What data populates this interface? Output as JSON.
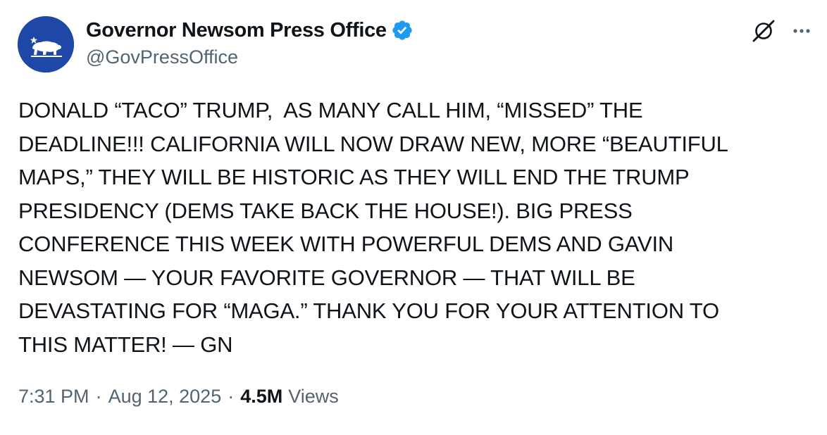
{
  "author": {
    "display_name": "Governor Newsom Press Office",
    "handle": "@GovPressOffice",
    "verified": true,
    "avatar_icon": "california-bear-icon",
    "avatar_color": "#1f47a8",
    "verified_color": "#1d9bf0"
  },
  "tweet": {
    "text_lines": [
      "DONALD “TACO” TRUMP,  AS MANY CALL HIM, “MISSED” THE",
      "DEADLINE!!! CALIFORNIA WILL NOW DRAW NEW, MORE “BEAUTIFUL",
      "MAPS,” THEY WILL BE HISTORIC AS THEY WILL END THE TRUMP",
      "PRESIDENCY (DEMS TAKE BACK THE HOUSE!). BIG PRESS",
      "CONFERENCE THIS WEEK WITH POWERFUL DEMS AND GAVIN",
      "NEWSOM — YOUR FAVORITE GOVERNOR — THAT WILL BE",
      "DEVASTATING FOR “MAGA.” THANK YOU FOR YOUR ATTENTION TO",
      "THIS MATTER! — GN"
    ]
  },
  "meta": {
    "time": "7:31 PM",
    "separator": "·",
    "date": "Aug 12, 2025",
    "views_count": "4.5M",
    "views_label": "Views"
  },
  "actions": {
    "grok_icon": "grok-icon",
    "more_icon": "more-options-icon"
  }
}
